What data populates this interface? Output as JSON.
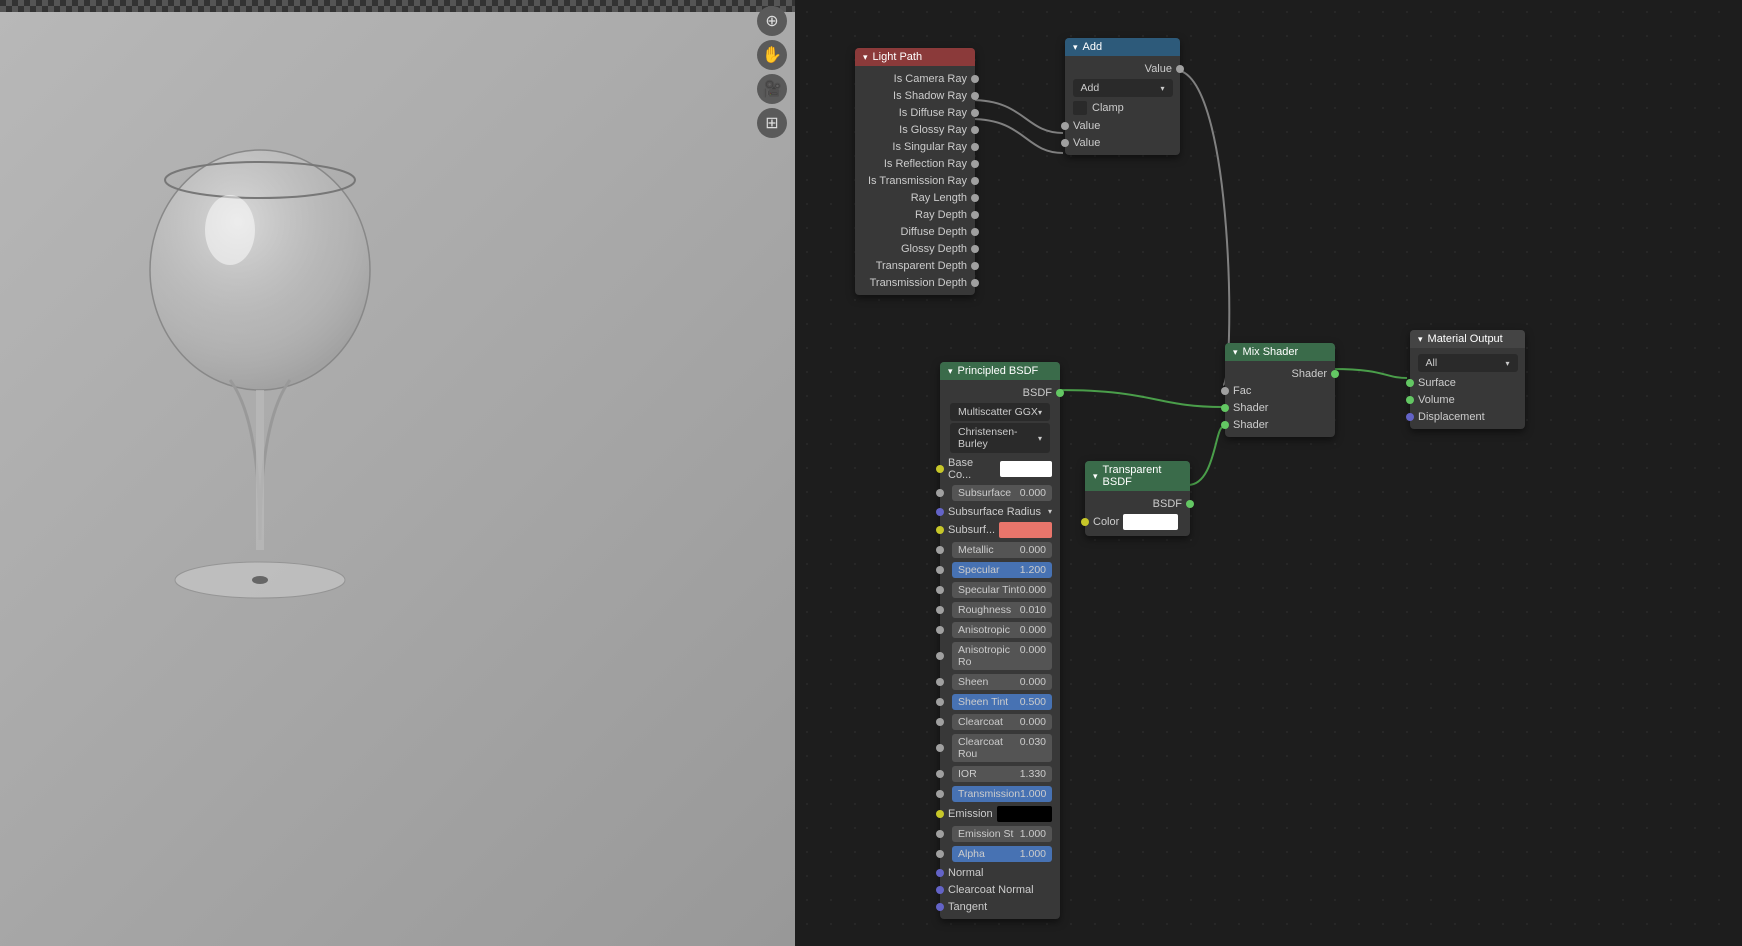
{
  "viewport_buttons": [
    "zoom",
    "pan",
    "camera",
    "grid"
  ],
  "nodes": {
    "light_path": {
      "title": "Light Path",
      "outputs": [
        "Is Camera Ray",
        "Is Shadow Ray",
        "Is Diffuse Ray",
        "Is Glossy Ray",
        "Is Singular Ray",
        "Is Reflection Ray",
        "Is Transmission Ray",
        "Ray Length",
        "Ray Depth",
        "Diffuse Depth",
        "Glossy Depth",
        "Transparent Depth",
        "Transmission Depth"
      ]
    },
    "add": {
      "title": "Add",
      "output": "Value",
      "mode": "Add",
      "clamp": "Clamp",
      "inputs": [
        "Value",
        "Value"
      ]
    },
    "principled": {
      "title": "Principled BSDF",
      "output": "BSDF",
      "dd1": "Multiscatter GGX",
      "dd2": "Christensen-Burley",
      "base_color_label": "Base Co...",
      "base_color": "#ffffff",
      "subsurf_label": "Subsurf...",
      "subsurf_color": "#e8756b",
      "subsurf_radius": "Subsurface Radius",
      "emission_label": "Emission",
      "emission_color": "#000000",
      "sliders": [
        {
          "name": "Subsurface",
          "val": "0.000",
          "active": false
        },
        {
          "name": "Metallic",
          "val": "0.000",
          "active": false
        },
        {
          "name": "Specular",
          "val": "1.200",
          "active": true
        },
        {
          "name": "Specular Tint",
          "val": "0.000",
          "active": false
        },
        {
          "name": "Roughness",
          "val": "0.010",
          "active": false
        },
        {
          "name": "Anisotropic",
          "val": "0.000",
          "active": false
        },
        {
          "name": "Anisotropic Ro",
          "val": "0.000",
          "active": false
        },
        {
          "name": "Sheen",
          "val": "0.000",
          "active": false
        },
        {
          "name": "Sheen Tint",
          "val": "0.500",
          "active": true
        },
        {
          "name": "Clearcoat",
          "val": "0.000",
          "active": false
        },
        {
          "name": "Clearcoat Rou",
          "val": "0.030",
          "active": false
        },
        {
          "name": "IOR",
          "val": "1.330",
          "active": false
        },
        {
          "name": "Transmission",
          "val": "1.000",
          "active": true
        },
        {
          "name": "Emission St",
          "val": "1.000",
          "active": false
        },
        {
          "name": "Alpha",
          "val": "1.000",
          "active": true
        }
      ],
      "vec_inputs": [
        "Normal",
        "Clearcoat Normal",
        "Tangent"
      ]
    },
    "transparent": {
      "title": "Transparent BSDF",
      "output": "BSDF",
      "color_label": "Color",
      "color": "#ffffff"
    },
    "mix": {
      "title": "Mix Shader",
      "output": "Shader",
      "inputs": [
        "Fac",
        "Shader",
        "Shader"
      ]
    },
    "material_output": {
      "title": "Material Output",
      "target": "All",
      "inputs": [
        "Surface",
        "Volume",
        "Displacement"
      ]
    }
  }
}
